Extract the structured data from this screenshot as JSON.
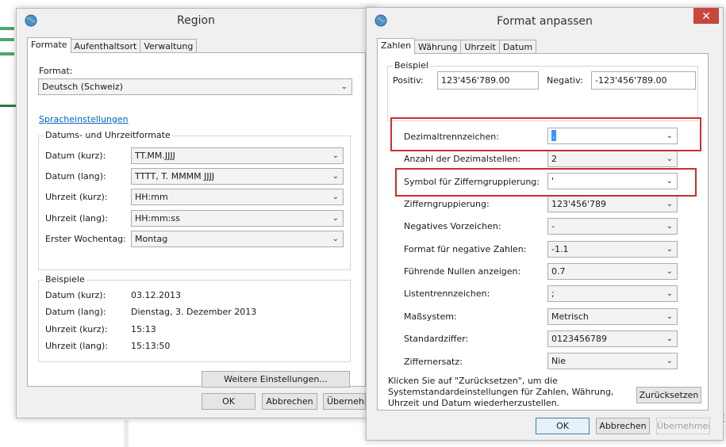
{
  "region": {
    "title": "Region",
    "tabs": [
      "Formate",
      "Aufenthaltsort",
      "Verwaltung"
    ],
    "format_label": "Format:",
    "format_value": "Deutsch (Schweiz)",
    "language_link": "Spracheinstellungen",
    "datetime_group": "Datums- und Uhrzeitformate",
    "datetime_rows": [
      {
        "label": "Datum (kurz):",
        "value": "TT.MM.JJJJ"
      },
      {
        "label": "Datum (lang):",
        "value": "TTTT, T. MMMM JJJJ"
      },
      {
        "label": "Uhrzeit (kurz):",
        "value": "HH:mm"
      },
      {
        "label": "Uhrzeit (lang):",
        "value": "HH:mm:ss"
      },
      {
        "label": "Erster Wochentag:",
        "value": "Montag"
      }
    ],
    "examples_group": "Beispiele",
    "examples": [
      {
        "label": "Datum (kurz):",
        "value": "03.12.2013"
      },
      {
        "label": "Datum (lang):",
        "value": "Dienstag, 3. Dezember 2013"
      },
      {
        "label": "Uhrzeit (kurz):",
        "value": "15:13"
      },
      {
        "label": "Uhrzeit (lang):",
        "value": "15:13:50"
      }
    ],
    "more_settings": "Weitere Einstellungen...",
    "ok": "OK",
    "cancel": "Abbrechen",
    "apply": "Übernehmen"
  },
  "format": {
    "title": "Format anpassen",
    "close": "✕",
    "tabs": [
      "Zahlen",
      "Währung",
      "Uhrzeit",
      "Datum"
    ],
    "example_group": "Beispiel",
    "positive_label": "Positiv:",
    "positive_value": "123'456'789.00",
    "negative_label": "Negativ:",
    "negative_value": "-123'456'789.00",
    "rows": [
      {
        "label": "Dezimaltrennzeichen:",
        "value": "."
      },
      {
        "label": "Anzahl der Dezimalstellen:",
        "value": "2"
      },
      {
        "label": "Symbol für Zifferngruppierung:",
        "value": "'"
      },
      {
        "label": "Zifferngruppierung:",
        "value": "123'456'789"
      },
      {
        "label": "Negatives Vorzeichen:",
        "value": "-"
      },
      {
        "label": "Format für negative Zahlen:",
        "value": "-1.1"
      },
      {
        "label": "Führende Nullen anzeigen:",
        "value": "0.7"
      },
      {
        "label": "Listentrennzeichen:",
        "value": ";"
      },
      {
        "label": "Maßsystem:",
        "value": "Metrisch"
      },
      {
        "label": "Standardziffer:",
        "value": "0123456789"
      },
      {
        "label": "Ziffernersatz:",
        "value": "Nie"
      }
    ],
    "reset_note": "Klicken Sie auf \"Zurücksetzen\", um die Systemstandardeinstellungen für Zahlen, Währung, Uhrzeit und Datum wiederherzustellen.",
    "reset": "Zurücksetzen",
    "ok": "OK",
    "cancel": "Abbrechen",
    "apply": "Übernehmen"
  },
  "background_tail": "E\ni",
  "colors": {
    "highlight": "#cc2f2f",
    "link": "#0066cc",
    "close": "#c9463d"
  }
}
